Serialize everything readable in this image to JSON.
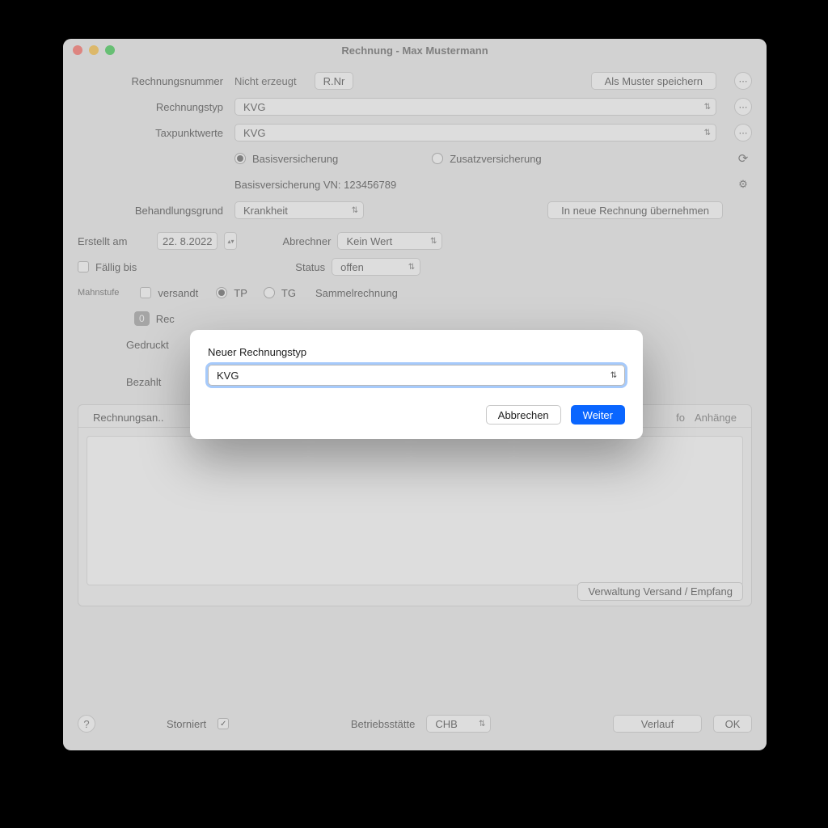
{
  "window": {
    "title": "Rechnung - Max Mustermann"
  },
  "labels": {
    "rechnungsnummer": "Rechnungsnummer",
    "rechnungstyp": "Rechnungstyp",
    "taxpunktwerte": "Taxpunktwerte",
    "behandlungsgrund": "Behandlungsgrund",
    "erstellt_am": "Erstellt am",
    "abrechner": "Abrechner",
    "faellig_bis": "Fällig bis",
    "status": "Status",
    "mahnstufe": "Mahnstufe",
    "versandt": "versandt",
    "tp": "TP",
    "tg": "TG",
    "sammelrechnung": "Sammelrechnung",
    "gedruckt": "Gedruckt",
    "bezahlt": "Bezahlt",
    "storniert": "Storniert",
    "betriebsstaette": "Betriebsstätte"
  },
  "values": {
    "nicht_erzeugt": "Nicht erzeugt",
    "rechnungstyp": "KVG",
    "taxpunktwerte": "KVG",
    "versicherung_basis": "Basisversicherung",
    "versicherung_zusatz": "Zusatzversicherung",
    "basis_detail": "Basisversicherung   VN: 123456789",
    "behandlungsgrund": "Krankheit",
    "erstellt_am": "22.  8.2022",
    "abrechner": "Kein Wert",
    "status": "offen",
    "mahnstufe_count": "0",
    "rec_prefix": "Rec",
    "betriebsstaette": "CHB"
  },
  "buttons": {
    "rnr": "R.Nr",
    "als_muster": "Als Muster speichern",
    "in_neue_rechnung": "In neue Rechnung übernehmen",
    "versand": "Verwaltung Versand / Empfang",
    "verlauf": "Verlauf",
    "ok": "OK"
  },
  "tabs": {
    "rechnungsan": "Rechnungsan..",
    "fo": "fo",
    "anhaenge": "Anhänge"
  },
  "modal": {
    "label": "Neuer Rechnungstyp",
    "value": "KVG",
    "cancel": "Abbrechen",
    "confirm": "Weiter"
  }
}
